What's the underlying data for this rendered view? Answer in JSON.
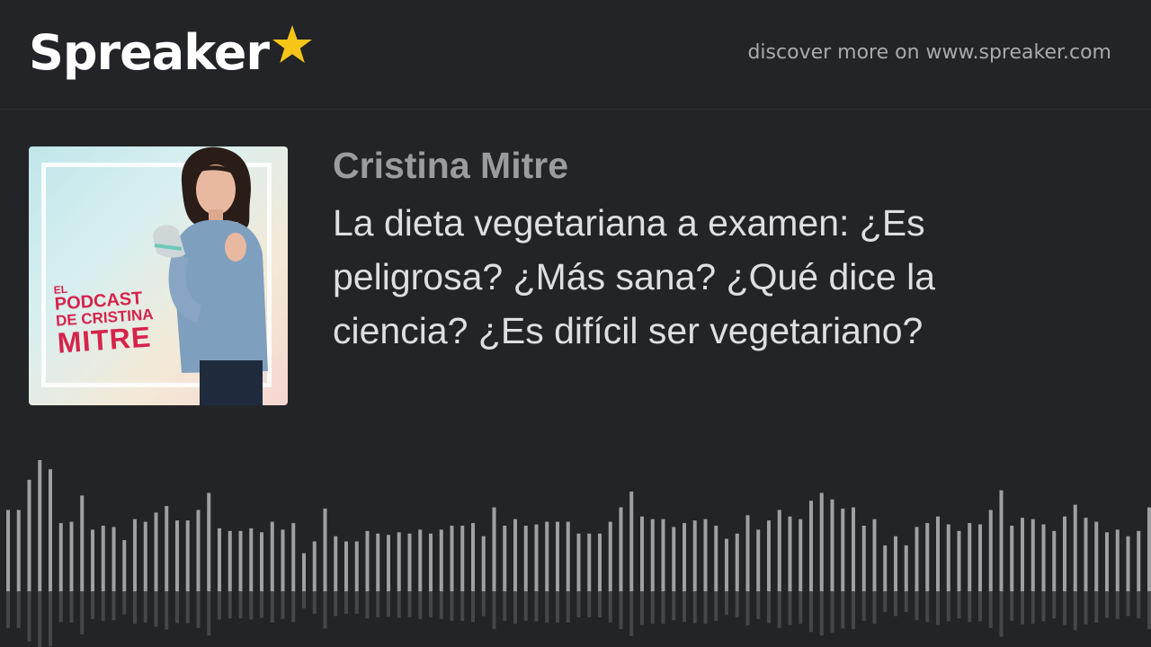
{
  "header": {
    "logo_text": "Spreaker",
    "logo_star_color": "#f6c517",
    "discover_text": "discover more on www.spreaker.com"
  },
  "podcast": {
    "cover": {
      "title_l1": "EL",
      "title_l2": "PODCAST",
      "title_l3": "DE CRISTINA",
      "title_l4": "MITRE"
    },
    "author": "Cristina Mitre",
    "episode_title": "La dieta vegetariana a examen: ¿Es peligrosa? ¿Más sana? ¿Qué dice la ciencia? ¿Es difícil ser vegetariano?"
  },
  "waveform": {
    "bar_color": "#9fa0a3",
    "levels": [
      0.62,
      0.62,
      0.85,
      1.0,
      0.93,
      0.52,
      0.53,
      0.73,
      0.47,
      0.5,
      0.49,
      0.39,
      0.55,
      0.53,
      0.6,
      0.65,
      0.54,
      0.54,
      0.62,
      0.75,
      0.48,
      0.46,
      0.46,
      0.48,
      0.45,
      0.53,
      0.47,
      0.52,
      0.29,
      0.38,
      0.63,
      0.42,
      0.38,
      0.38,
      0.46,
      0.44,
      0.43,
      0.45,
      0.44,
      0.47,
      0.44,
      0.47,
      0.5,
      0.5,
      0.52,
      0.42,
      0.64,
      0.5,
      0.55,
      0.5,
      0.51,
      0.53,
      0.53,
      0.53,
      0.44,
      0.44,
      0.44,
      0.53,
      0.64,
      0.76,
      0.57,
      0.55,
      0.55,
      0.49,
      0.52,
      0.54,
      0.55,
      0.5,
      0.4,
      0.44,
      0.58,
      0.47,
      0.54,
      0.62,
      0.57,
      0.55,
      0.69,
      0.75,
      0.7,
      0.63,
      0.64,
      0.5,
      0.55,
      0.35,
      0.42,
      0.35,
      0.49,
      0.52,
      0.57,
      0.51,
      0.46,
      0.52,
      0.51,
      0.62,
      0.77,
      0.5,
      0.56,
      0.55,
      0.51,
      0.46,
      0.57,
      0.66,
      0.56,
      0.53,
      0.45,
      0.47,
      0.42,
      0.46,
      0.64,
      0.84
    ]
  }
}
